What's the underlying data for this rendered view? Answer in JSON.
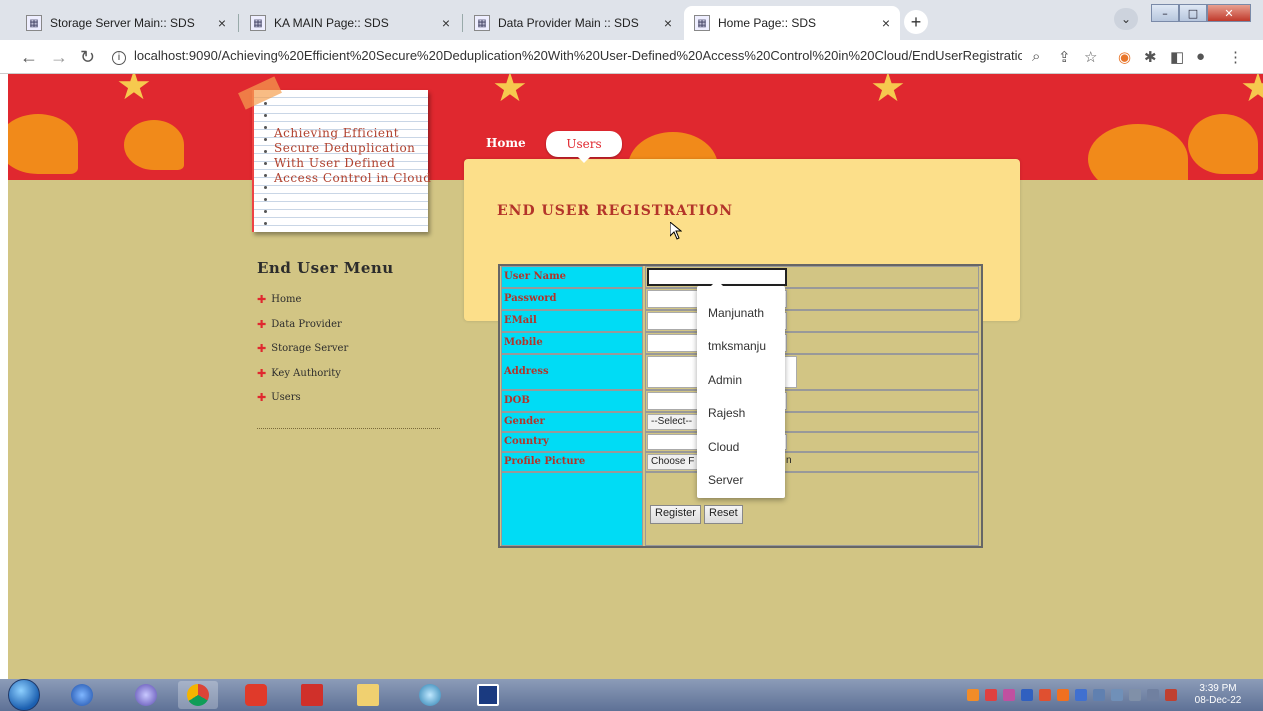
{
  "browser": {
    "tabs": [
      {
        "title": "Storage Server Main:: SDS",
        "active": false
      },
      {
        "title": "KA MAIN Page:: SDS",
        "active": false
      },
      {
        "title": "Data Provider Main :: SDS",
        "active": false
      },
      {
        "title": "Home Page:: SDS",
        "active": true
      }
    ],
    "new_tab": "+",
    "close_glyph": "×",
    "url": "localhost:9090/Achieving%20Efficient%20Secure%20Deduplication%20With%20User-Defined%20Access%20Control%20in%20Cloud/EndUserRegistratio..."
  },
  "site": {
    "title": "Achieving Efficient\nSecure Deduplication\nWith User Defined\nAccess Control in Cloud",
    "nav": {
      "home": "Home",
      "users": "Users"
    },
    "page_title": "END USER REGISTRATION"
  },
  "menu": {
    "title": "End User Menu",
    "items": [
      "Home",
      "Data Provider",
      "Storage Server",
      "Key Authority",
      "Users"
    ]
  },
  "form": {
    "labels": {
      "username": "User Name",
      "password": "Password",
      "email": "EMail",
      "mobile": "Mobile",
      "address": "Address",
      "dob": "DOB",
      "gender": "Gender",
      "country": "Country",
      "picture": "Profile Picture"
    },
    "gender_select": "--Select--",
    "file_button_visible": "Choose F",
    "file_status_visible": "n",
    "register": "Register",
    "reset": "Reset"
  },
  "autocomplete": {
    "options": [
      "Manjunath",
      "tmksmanju",
      "Admin",
      "Rajesh",
      "Cloud",
      "Server"
    ]
  },
  "taskbar": {
    "time": "3:39 PM",
    "date": "08-Dec-22"
  },
  "colors": {
    "banner_red": "#e0282f",
    "page_bg": "#d2c584",
    "label_cyan": "#00dcf5",
    "label_text": "#b3342a",
    "panel_yellow": "#fcdf8a"
  }
}
